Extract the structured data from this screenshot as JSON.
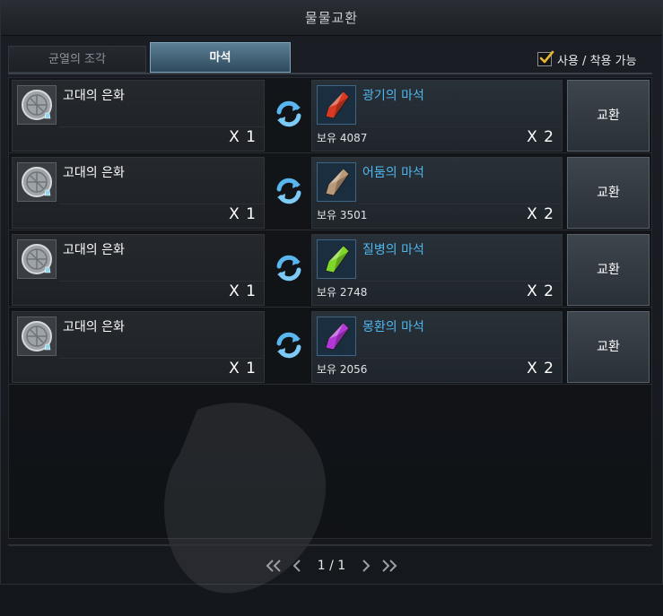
{
  "window": {
    "title": "물물교환"
  },
  "tabs": [
    {
      "label": "균열의 조각",
      "active": false
    },
    {
      "label": "마석",
      "active": true
    }
  ],
  "filter": {
    "label": "사용 / 착용 가능",
    "checked": true
  },
  "rows": [
    {
      "give": {
        "name": "고대의 은화",
        "qty": "X 1",
        "icon": "ancient-silver-coin-icon"
      },
      "receive": {
        "name": "광기의 마석",
        "owned": "보유 4087",
        "qty": "X 2",
        "icon": "red-magic-stone-icon",
        "color": "#d63a22"
      },
      "button": "교환"
    },
    {
      "give": {
        "name": "고대의 은화",
        "qty": "X 1",
        "icon": "ancient-silver-coin-icon"
      },
      "receive": {
        "name": "어둠의 마석",
        "owned": "보유 3501",
        "qty": "X 2",
        "icon": "tan-magic-stone-icon",
        "color": "#b89a78"
      },
      "button": "교환"
    },
    {
      "give": {
        "name": "고대의 은화",
        "qty": "X 1",
        "icon": "ancient-silver-coin-icon"
      },
      "receive": {
        "name": "질병의 마석",
        "owned": "보유 2748",
        "qty": "X 2",
        "icon": "green-magic-stone-icon",
        "color": "#7fd62a"
      },
      "button": "교환"
    },
    {
      "give": {
        "name": "고대의 은화",
        "qty": "X 1",
        "icon": "ancient-silver-coin-icon"
      },
      "receive": {
        "name": "몽환의 마석",
        "owned": "보유 2056",
        "qty": "X 2",
        "icon": "purple-magic-stone-icon",
        "color": "#b437d8"
      },
      "button": "교환"
    }
  ],
  "pager": {
    "text": "1 / 1"
  },
  "colors": {
    "accent": "#4fb8f0",
    "checkmark": "#e8b730",
    "tab_active": "#3f6378"
  }
}
